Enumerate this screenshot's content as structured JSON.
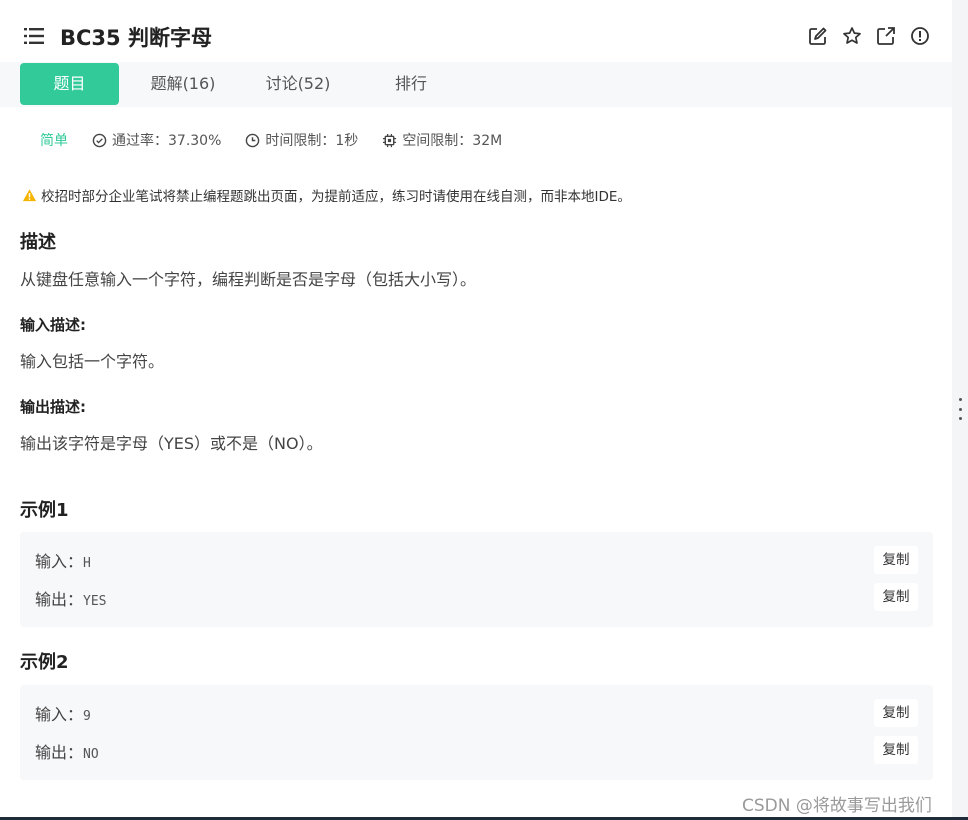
{
  "header": {
    "title": "BC35  判断字母",
    "tools": [
      "edit-icon",
      "star-icon",
      "external-link-icon",
      "alert-circle-icon"
    ]
  },
  "tabs": [
    {
      "label": "题目",
      "active": true
    },
    {
      "label": "题解(16)",
      "active": false
    },
    {
      "label": "讨论(52)",
      "active": false
    },
    {
      "label": "排行",
      "active": false
    }
  ],
  "meta": {
    "level": "简单",
    "pass_rate": "通过率：37.30%",
    "time_limit": "时间限制：1秒",
    "space_limit": "空间限制：32M"
  },
  "warning": "校招时部分企业笔试将禁止编程题跳出页面，为提前适应，练习时请使用在线自测，而非本地IDE。",
  "description": {
    "heading": "描述",
    "text": "从键盘任意输入一个字符，编程判断是否是字母（包括大小写）。"
  },
  "input_desc": {
    "heading": "输入描述:",
    "text": "输入包括一个字符。"
  },
  "output_desc": {
    "heading": "输出描述:",
    "text": "输出该字符是字母（YES）或不是（NO）。"
  },
  "examples": [
    {
      "heading": "示例1",
      "input_label": "输入：",
      "input": "H",
      "output_label": "输出：",
      "output": "YES",
      "copy_label": "复制"
    },
    {
      "heading": "示例2",
      "input_label": "输入：",
      "input": "9",
      "output_label": "输出：",
      "output": "NO",
      "copy_label": "复制"
    }
  ],
  "watermark": "CSDN @将故事写出我们",
  "colors": {
    "accent": "#32ca99",
    "panel_bg": "#f7f8fa"
  }
}
